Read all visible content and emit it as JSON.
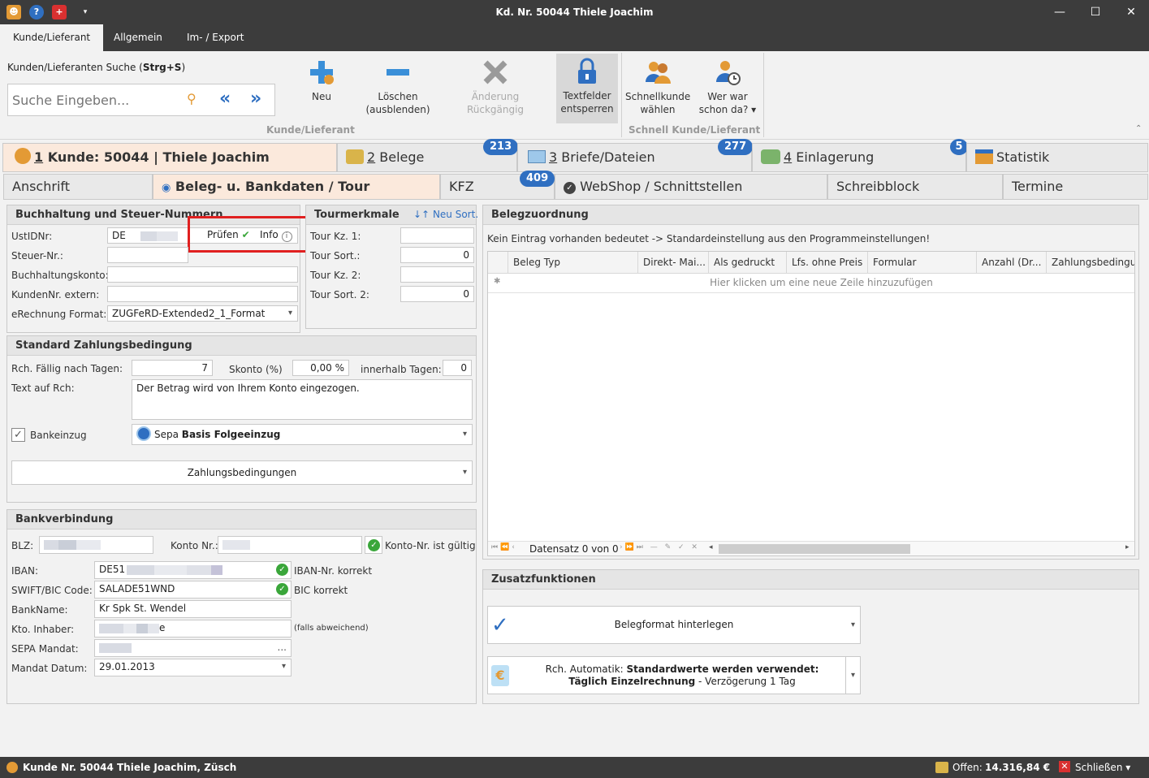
{
  "window": {
    "title": "Kd. Nr. 50044 Thiele Joachim",
    "minimize": "—",
    "maximize": "☐",
    "close": "✕"
  },
  "menu": {
    "tabs": [
      "Kunde/Lieferant",
      "Allgemein",
      "Im- / Export"
    ]
  },
  "ribbon": {
    "search_label_prefix": "Kunden/Lieferanten Suche (",
    "search_shortcut": "Strg+S",
    "search_label_suffix": ")",
    "search_placeholder": "Suche Eingeben...",
    "btn_neu": "Neu",
    "btn_loeschen_1": "Löschen",
    "btn_loeschen_2": "(ausblenden)",
    "btn_aenderung": "Änderung Rückgängig",
    "btn_textfelder_1": "Textfelder",
    "btn_textfelder_2": "entsperren",
    "btn_schnellkunde_1": "Schnellkunde",
    "btn_schnellkunde_2": "wählen",
    "btn_werwar_1": "Wer war",
    "btn_werwar_2": "schon da? ▾",
    "group1": "Kunde/Lieferant",
    "group2": "Schnell Kunde/Lieferant"
  },
  "main_tabs": {
    "kunde_num": "1",
    "kunde": " Kunde: 50044 | Thiele Joachim",
    "belege_num": "2",
    "belege": " Belege",
    "belege_badge": "213",
    "briefe_num": "3",
    "briefe": " Briefe/Dateien",
    "briefe_badge": "277",
    "einlagerung_num": "4",
    "einlagerung": " Einlagerung",
    "einlagerung_badge": "5",
    "statistik": "Statistik"
  },
  "sub_tabs": {
    "anschrift": "Anschrift",
    "beleg": "Beleg- u. Bankdaten / Tour",
    "kfz": "KFZ",
    "kfz_badge": "409",
    "webshop": "WebShop / Schnittstellen",
    "schreibblock": "Schreibblock",
    "termine": "Termine"
  },
  "buchhaltung": {
    "title": "Buchhaltung und Steuer-Nummern",
    "ustid_label": "UstIDNr:",
    "ustid_value": "DE",
    "pruefen": "Prüfen",
    "info": "Info",
    "steuer_label": "Steuer-Nr.:",
    "buchkonto_label": "Buchhaltungskonto:",
    "kundennr_label": "KundenNr. extern:",
    "erechnung_label": "eRechnung Format:",
    "erechnung_value": "ZUGFeRD-Extended2_1_Format"
  },
  "tour": {
    "title": "Tourmerkmale",
    "neu_sort": "Neu Sort.",
    "kz1_label": "Tour Kz. 1:",
    "sort_label": "Tour Sort.:",
    "sort_value": "0",
    "kz2_label": "Tour Kz. 2:",
    "sort2_label": "Tour Sort. 2:",
    "sort2_value": "0"
  },
  "zahlung": {
    "title": "Standard Zahlungsbedingung",
    "faellig_label": "Rch. Fällig nach Tagen:",
    "faellig_value": "7",
    "skonto_label": "Skonto (%)",
    "skonto_value": "0,00 %",
    "innerhalb_label": "innerhalb Tagen:",
    "innerhalb_value": "0",
    "text_label": "Text auf Rch:",
    "text_value": "Der Betrag wird von Ihrem Konto eingezogen.",
    "bankeinzug": "Bankeinzug",
    "sepa_prefix": "Sepa ",
    "sepa_bold": "Basis Folgeeinzug",
    "zahlungsbedingungen": "Zahlungsbedingungen"
  },
  "bank": {
    "title": "Bankverbindung",
    "blz_label": "BLZ:",
    "konto_label": "Konto Nr.:",
    "konto_valid": "Konto-Nr. ist gültig",
    "iban_label": "IBAN:",
    "iban_value": "DE51",
    "iban_ok": "IBAN-Nr. korrekt",
    "swift_label": "SWIFT/BIC Code:",
    "swift_value": "SALADE51WND",
    "bic_ok": "BIC korrekt",
    "bankname_label": "BankName:",
    "bankname_value": "Kr Spk St. Wendel",
    "inhaber_label": "Kto. Inhaber:",
    "inhaber_suffix": "e",
    "falls": "(falls abweichend)",
    "sepa_mandat_label": "SEPA Mandat:",
    "mandat_datum_label": "Mandat Datum:",
    "mandat_datum_value": "29.01.2013"
  },
  "belegzuordnung": {
    "title": "Belegzuordnung",
    "hint": "Kein Eintrag vorhanden bedeutet -> Standardeinstellung aus den Programmeinstellungen!",
    "columns": [
      "Beleg Typ",
      "Direkt- Mai...",
      "Als gedruckt",
      "Lfs. ohne Preis",
      "Formular",
      "Anzahl (Dr...",
      "Zahlungsbedingun"
    ],
    "new_row": "Hier klicken um eine neue Zeile hinzuzufügen",
    "datensatz": "Datensatz 0 von 0"
  },
  "zusatz": {
    "title": "Zusatzfunktionen",
    "belegformat": "Belegformat hinterlegen",
    "rch_prefix": "Rch. Automatik: ",
    "rch_bold": "Standardwerte werden verwendet:",
    "rch_line2_bold": "Täglich Einzelrechnung",
    "rch_line2_rest": " - Verzögerung 1 Tag"
  },
  "status": {
    "left": "Kunde Nr. 50044 Thiele Joachim, Züsch",
    "offen_label": "Offen: ",
    "offen_value": "14.316,84 €",
    "schliessen": "Schließen ▾"
  },
  "colors": {
    "accent": "#2f6fc1",
    "titlebar": "#3c3c3c",
    "active_tab": "#fbe9dc",
    "highlight_box": "#e02020",
    "ok_green": "#3aa63a"
  }
}
